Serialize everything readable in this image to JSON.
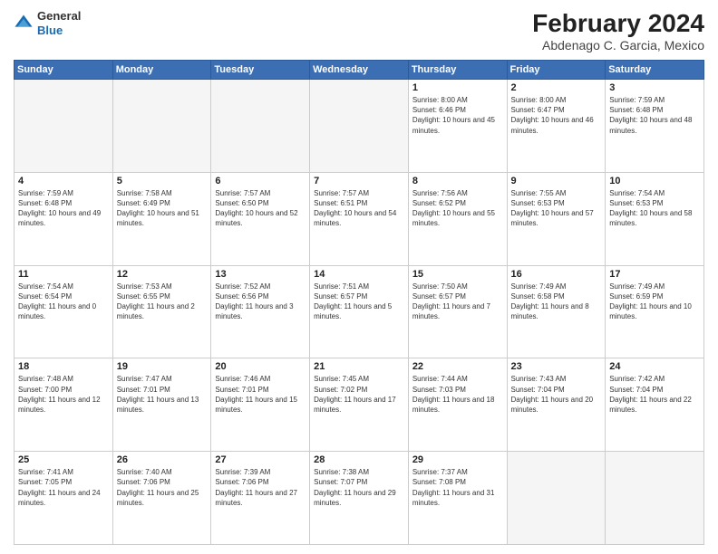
{
  "header": {
    "logo": {
      "general": "General",
      "blue": "Blue"
    },
    "title": "February 2024",
    "location": "Abdenago C. Garcia, Mexico"
  },
  "days_of_week": [
    "Sunday",
    "Monday",
    "Tuesday",
    "Wednesday",
    "Thursday",
    "Friday",
    "Saturday"
  ],
  "weeks": [
    [
      {
        "day": "",
        "empty": true
      },
      {
        "day": "",
        "empty": true
      },
      {
        "day": "",
        "empty": true
      },
      {
        "day": "",
        "empty": true
      },
      {
        "day": "1",
        "sunrise": "Sunrise: 8:00 AM",
        "sunset": "Sunset: 6:46 PM",
        "daylight": "Daylight: 10 hours and 45 minutes."
      },
      {
        "day": "2",
        "sunrise": "Sunrise: 8:00 AM",
        "sunset": "Sunset: 6:47 PM",
        "daylight": "Daylight: 10 hours and 46 minutes."
      },
      {
        "day": "3",
        "sunrise": "Sunrise: 7:59 AM",
        "sunset": "Sunset: 6:48 PM",
        "daylight": "Daylight: 10 hours and 48 minutes."
      }
    ],
    [
      {
        "day": "4",
        "sunrise": "Sunrise: 7:59 AM",
        "sunset": "Sunset: 6:48 PM",
        "daylight": "Daylight: 10 hours and 49 minutes."
      },
      {
        "day": "5",
        "sunrise": "Sunrise: 7:58 AM",
        "sunset": "Sunset: 6:49 PM",
        "daylight": "Daylight: 10 hours and 51 minutes."
      },
      {
        "day": "6",
        "sunrise": "Sunrise: 7:57 AM",
        "sunset": "Sunset: 6:50 PM",
        "daylight": "Daylight: 10 hours and 52 minutes."
      },
      {
        "day": "7",
        "sunrise": "Sunrise: 7:57 AM",
        "sunset": "Sunset: 6:51 PM",
        "daylight": "Daylight: 10 hours and 54 minutes."
      },
      {
        "day": "8",
        "sunrise": "Sunrise: 7:56 AM",
        "sunset": "Sunset: 6:52 PM",
        "daylight": "Daylight: 10 hours and 55 minutes."
      },
      {
        "day": "9",
        "sunrise": "Sunrise: 7:55 AM",
        "sunset": "Sunset: 6:53 PM",
        "daylight": "Daylight: 10 hours and 57 minutes."
      },
      {
        "day": "10",
        "sunrise": "Sunrise: 7:54 AM",
        "sunset": "Sunset: 6:53 PM",
        "daylight": "Daylight: 10 hours and 58 minutes."
      }
    ],
    [
      {
        "day": "11",
        "sunrise": "Sunrise: 7:54 AM",
        "sunset": "Sunset: 6:54 PM",
        "daylight": "Daylight: 11 hours and 0 minutes."
      },
      {
        "day": "12",
        "sunrise": "Sunrise: 7:53 AM",
        "sunset": "Sunset: 6:55 PM",
        "daylight": "Daylight: 11 hours and 2 minutes."
      },
      {
        "day": "13",
        "sunrise": "Sunrise: 7:52 AM",
        "sunset": "Sunset: 6:56 PM",
        "daylight": "Daylight: 11 hours and 3 minutes."
      },
      {
        "day": "14",
        "sunrise": "Sunrise: 7:51 AM",
        "sunset": "Sunset: 6:57 PM",
        "daylight": "Daylight: 11 hours and 5 minutes."
      },
      {
        "day": "15",
        "sunrise": "Sunrise: 7:50 AM",
        "sunset": "Sunset: 6:57 PM",
        "daylight": "Daylight: 11 hours and 7 minutes."
      },
      {
        "day": "16",
        "sunrise": "Sunrise: 7:49 AM",
        "sunset": "Sunset: 6:58 PM",
        "daylight": "Daylight: 11 hours and 8 minutes."
      },
      {
        "day": "17",
        "sunrise": "Sunrise: 7:49 AM",
        "sunset": "Sunset: 6:59 PM",
        "daylight": "Daylight: 11 hours and 10 minutes."
      }
    ],
    [
      {
        "day": "18",
        "sunrise": "Sunrise: 7:48 AM",
        "sunset": "Sunset: 7:00 PM",
        "daylight": "Daylight: 11 hours and 12 minutes."
      },
      {
        "day": "19",
        "sunrise": "Sunrise: 7:47 AM",
        "sunset": "Sunset: 7:01 PM",
        "daylight": "Daylight: 11 hours and 13 minutes."
      },
      {
        "day": "20",
        "sunrise": "Sunrise: 7:46 AM",
        "sunset": "Sunset: 7:01 PM",
        "daylight": "Daylight: 11 hours and 15 minutes."
      },
      {
        "day": "21",
        "sunrise": "Sunrise: 7:45 AM",
        "sunset": "Sunset: 7:02 PM",
        "daylight": "Daylight: 11 hours and 17 minutes."
      },
      {
        "day": "22",
        "sunrise": "Sunrise: 7:44 AM",
        "sunset": "Sunset: 7:03 PM",
        "daylight": "Daylight: 11 hours and 18 minutes."
      },
      {
        "day": "23",
        "sunrise": "Sunrise: 7:43 AM",
        "sunset": "Sunset: 7:04 PM",
        "daylight": "Daylight: 11 hours and 20 minutes."
      },
      {
        "day": "24",
        "sunrise": "Sunrise: 7:42 AM",
        "sunset": "Sunset: 7:04 PM",
        "daylight": "Daylight: 11 hours and 22 minutes."
      }
    ],
    [
      {
        "day": "25",
        "sunrise": "Sunrise: 7:41 AM",
        "sunset": "Sunset: 7:05 PM",
        "daylight": "Daylight: 11 hours and 24 minutes."
      },
      {
        "day": "26",
        "sunrise": "Sunrise: 7:40 AM",
        "sunset": "Sunset: 7:06 PM",
        "daylight": "Daylight: 11 hours and 25 minutes."
      },
      {
        "day": "27",
        "sunrise": "Sunrise: 7:39 AM",
        "sunset": "Sunset: 7:06 PM",
        "daylight": "Daylight: 11 hours and 27 minutes."
      },
      {
        "day": "28",
        "sunrise": "Sunrise: 7:38 AM",
        "sunset": "Sunset: 7:07 PM",
        "daylight": "Daylight: 11 hours and 29 minutes."
      },
      {
        "day": "29",
        "sunrise": "Sunrise: 7:37 AM",
        "sunset": "Sunset: 7:08 PM",
        "daylight": "Daylight: 11 hours and 31 minutes."
      },
      {
        "day": "",
        "empty": true
      },
      {
        "day": "",
        "empty": true
      }
    ]
  ]
}
